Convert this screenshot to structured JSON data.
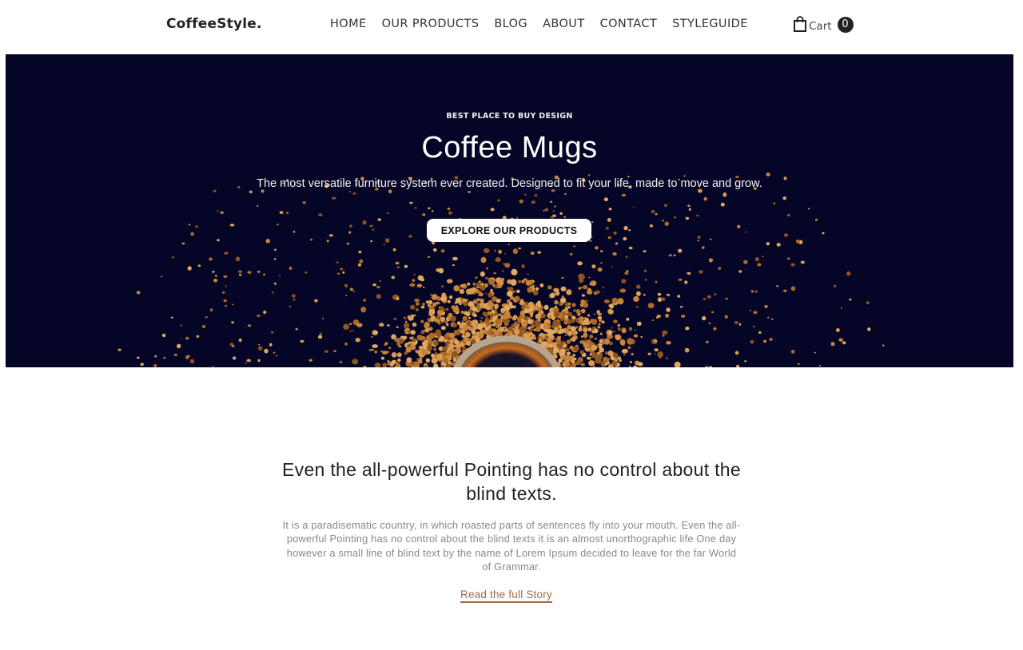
{
  "header": {
    "brand": "CoffeeStyle.",
    "nav": [
      "HOME",
      "OUR PRODUCTS",
      "BLOG",
      "ABOUT",
      "CONTACT",
      "STYLEGUIDE"
    ],
    "cart_label": "Cart",
    "cart_count": "0",
    "cart_icon": "shopping-bag-icon"
  },
  "hero": {
    "eyebrow": "BEST PLACE TO BUY DESIGN",
    "title": "Coffee Mugs",
    "subtitle": "The most versatile furniture system ever created. Designed to fit your life, made to move and grow.",
    "cta_label": "EXPLORE OUR PRODUCTS",
    "background_color": "#050627"
  },
  "story": {
    "heading": "Even the all-powerful Pointing has no control about the blind texts.",
    "body": "It is a paradisematic country, in which roasted parts of sentences fly into your mouth. Even the all-powerful Pointing has no control about the blind texts it is an almost unorthographic life One day however a small line of blind text by the name of Lorem Ipsum decided to leave for the far World of Grammar.",
    "link": "Read the full Story",
    "link_color": "#a16a4a"
  }
}
